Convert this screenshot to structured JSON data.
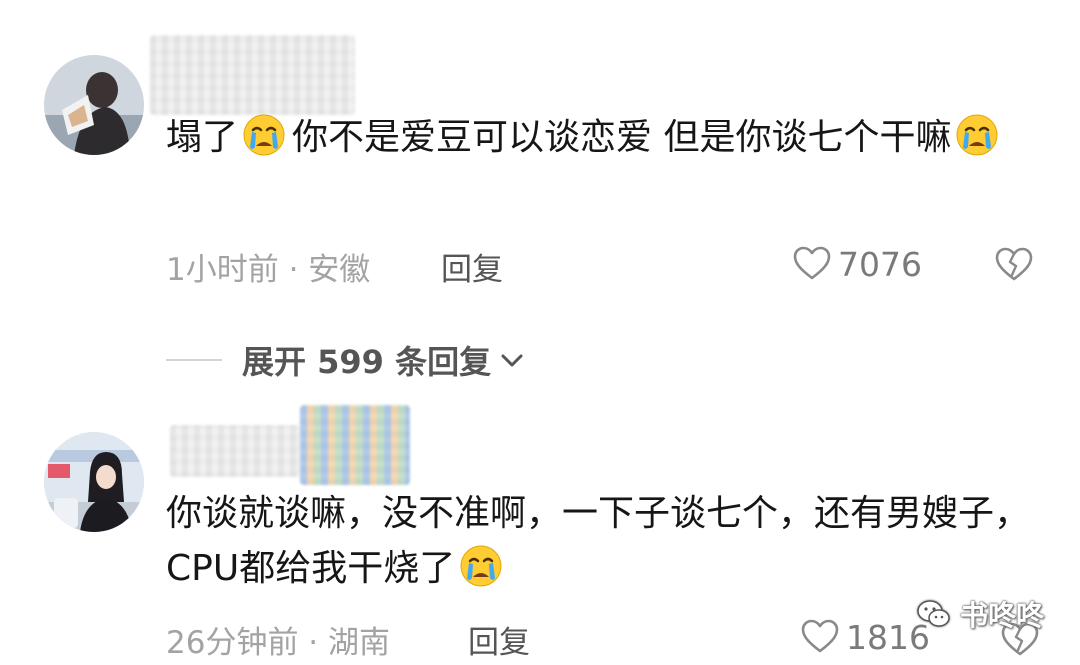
{
  "comments": [
    {
      "avatar": "user-avatar-photo",
      "username": "",
      "text_parts": [
        "塌了",
        "你不是爱豆可以谈恋爱 但是你谈七个干嘛",
        ""
      ],
      "emoji": "crying-face",
      "meta": "1小时前 · 安徽",
      "reply_label": "回复",
      "likes": "7076"
    },
    {
      "avatar": "user-avatar-photo",
      "username": "",
      "text": "你谈就谈嘛，没不准啊，一下子谈七个，还有男嫂子，CPU都给我干烧了",
      "emoji": "crying-face",
      "meta": "26分钟前 · 湖南",
      "reply_label": "回复",
      "likes": "1816"
    }
  ],
  "expand_replies": {
    "label": "展开 599 条回复",
    "icon": "chevron-down-icon"
  },
  "watermark": {
    "text": "书咚咚",
    "icon": "wechat-icon"
  },
  "colors": {
    "text": "#161616",
    "meta": "#a3a3a3",
    "reply": "#555555",
    "like": "#7a7a7a"
  }
}
